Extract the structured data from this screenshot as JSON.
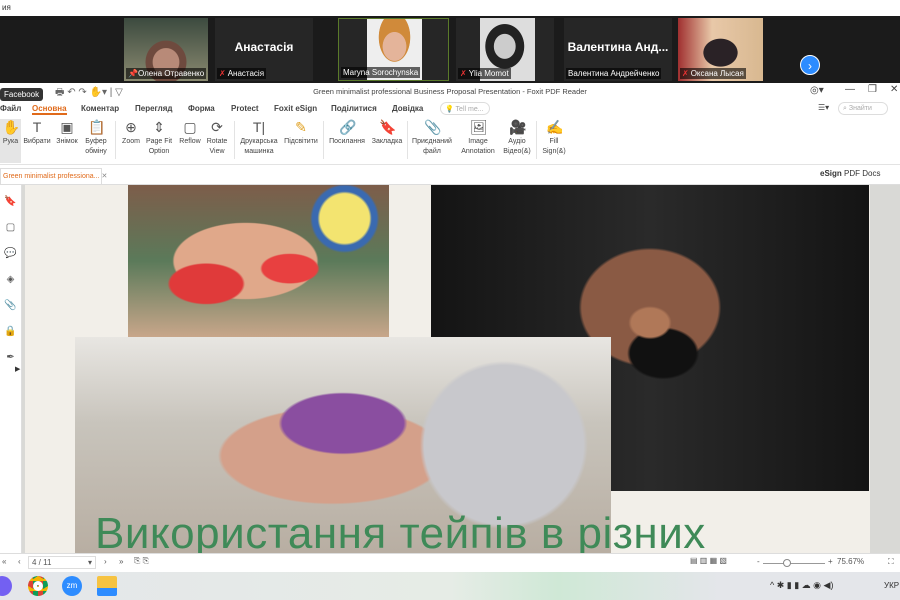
{
  "top_strip": {
    "text": "ия"
  },
  "zoom": {
    "participants": [
      {
        "name": "Олена Отравенко",
        "video": true,
        "muted": false,
        "pinned": true
      },
      {
        "name": "Анастасія",
        "display": "Анастасія",
        "video": false,
        "muted": true
      },
      {
        "name": "Maryna Sorochynska",
        "video": true,
        "muted": false,
        "active": true
      },
      {
        "name": "Ylia Momot",
        "video": true,
        "muted": true
      },
      {
        "name": "Валентина Андрейченко",
        "display": "Валентина  Анд...",
        "video": false,
        "muted": false
      },
      {
        "name": "Оксана Лысая",
        "video": true,
        "muted": true
      }
    ],
    "next_icon": "chevron-right-icon",
    "accent": "#2d8cff"
  },
  "tooltip": "Facebook",
  "app": {
    "title": "Green minimalist professional Business Proposal Presentation - Foxit PDF Reader"
  },
  "tabs": [
    "Файл",
    "Основна",
    "Коментар",
    "Перегляд",
    "Форма",
    "Protect",
    "Foxit eSign",
    "Поділитися",
    "Довідка"
  ],
  "active_tab": "Основна",
  "tell_me_placeholder": "Tell me...",
  "find_placeholder": "Знайти",
  "ribbon": [
    {
      "label": "Рука",
      "icon": "hand-icon"
    },
    {
      "label": "Вибрати",
      "icon": "select-text-icon"
    },
    {
      "label": "Знімок",
      "icon": "snapshot-icon"
    },
    {
      "label": "Буфер обміну",
      "icon": "clipboard-icon"
    },
    {
      "label": "Zoom",
      "icon": "zoom-icon"
    },
    {
      "label": "Page Fit Option",
      "icon": "page-fit-icon"
    },
    {
      "label": "Reflow",
      "icon": "reflow-icon"
    },
    {
      "label": "Rotate View",
      "icon": "rotate-icon"
    },
    {
      "label": "Друкарська машинка",
      "icon": "typewriter-icon"
    },
    {
      "label": "Підсвітити",
      "icon": "highlight-icon"
    },
    {
      "label": "Посилання",
      "icon": "link-icon"
    },
    {
      "label": "Закладка",
      "icon": "bookmark-icon"
    },
    {
      "label": "Приєднаний файл",
      "icon": "attach-file-icon"
    },
    {
      "label": "Image Annotation",
      "icon": "image-annotation-icon"
    },
    {
      "label": "Аудіо Відео(&)",
      "icon": "audio-video-icon"
    },
    {
      "label": "Fill Sign(&)",
      "icon": "fill-sign-icon"
    }
  ],
  "doc_tab": "Green minimalist professiona...",
  "esign_badge": {
    "bold": "eSign",
    "rest": "PDF Docs"
  },
  "slide": {
    "title": "Використання тейпів в різних",
    "title_color": "#3f8a58"
  },
  "status": {
    "page": "4 / 11",
    "zoom": "75.67%",
    "zoom_fraction": 0.38
  },
  "taskbar": {
    "apps": [
      "viber",
      "chrome",
      "zoom",
      "file-explorer"
    ],
    "lang": "УКР"
  }
}
